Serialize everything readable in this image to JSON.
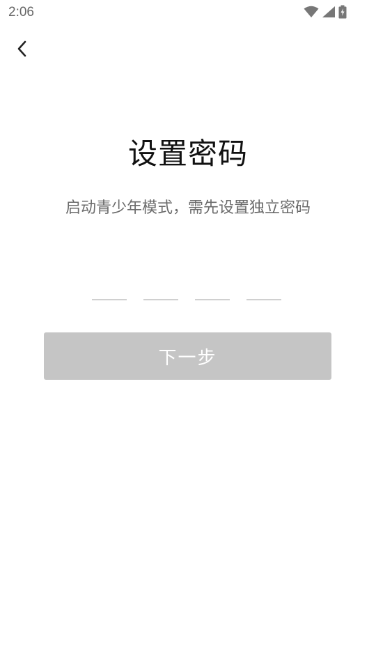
{
  "status_bar": {
    "time": "2:06",
    "icons": [
      "wifi-icon",
      "signal-icon",
      "battery-charging-icon"
    ]
  },
  "nav": {
    "back_icon": "chevron-left-icon"
  },
  "main": {
    "title": "设置密码",
    "subtitle": "启动青少年模式，需先设置独立密码",
    "pin_length": 4,
    "next_button_label": "下一步",
    "next_button_enabled": false
  },
  "colors": {
    "button_disabled_bg": "#c5c5c5",
    "button_text": "#ffffff",
    "title_text": "#111111",
    "subtitle_text": "#6b6b6b",
    "pin_underline": "#d0d0d0"
  }
}
